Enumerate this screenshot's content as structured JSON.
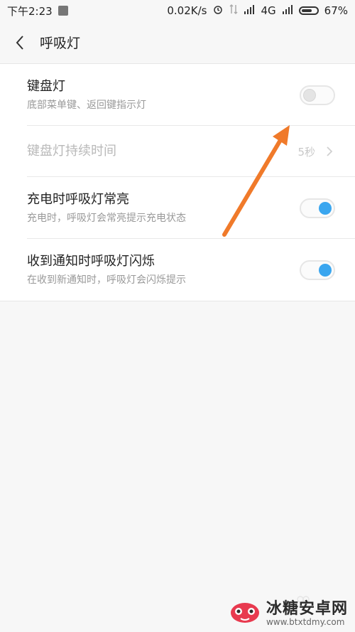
{
  "status_bar": {
    "time": "下午2:23",
    "network_speed": "0.02K/s",
    "network_type": "4G",
    "battery": "67%"
  },
  "header": {
    "title": "呼吸灯"
  },
  "settings": [
    {
      "title": "键盘灯",
      "subtitle": "底部菜单键、返回键指示灯",
      "control": "toggle",
      "state": "off"
    },
    {
      "title": "键盘灯持续时间",
      "value": "5秒",
      "control": "chevron",
      "disabled": true
    },
    {
      "title": "充电时呼吸灯常亮",
      "subtitle": "充电时，呼吸灯会常亮提示充电状态",
      "control": "toggle",
      "state": "on"
    },
    {
      "title": "收到通知时呼吸灯闪烁",
      "subtitle": "在收到新通知时，呼吸灯会闪烁提示",
      "control": "toggle",
      "state": "on"
    }
  ],
  "watermark": {
    "title": "冰糖安卓网",
    "url": "www.btxtdmy.com"
  },
  "colors": {
    "accent": "#3aa6ef",
    "annotation_arrow": "#f07a2a"
  }
}
